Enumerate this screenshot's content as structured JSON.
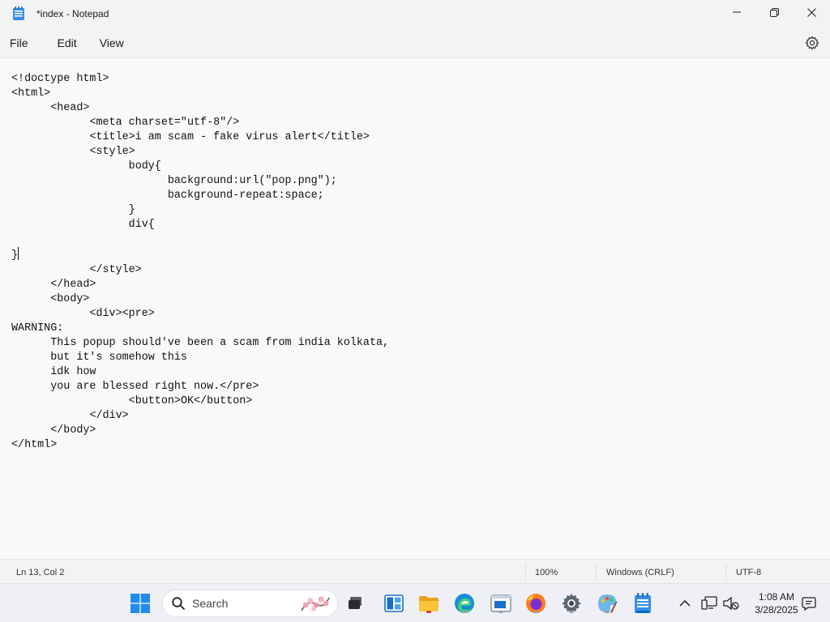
{
  "window": {
    "title": "*index - Notepad"
  },
  "menu": {
    "file": "File",
    "edit": "Edit",
    "view": "View"
  },
  "editor": {
    "code_before_caret": "<!doctype html>\n<html>\n\t<head>\n\t\t<meta charset=\"utf-8\"/>\n\t\t<title>i am scam - fake virus alert</title>\n\t\t<style>\n\t\t\tbody{\n\t\t\t\tbackground:url(\"pop.png\");\n\t\t\t\tbackground-repeat:space;\n\t\t\t}\n\t\t\tdiv{\n\n}",
    "code_after_caret": "\n\t\t</style>\n\t</head>\n\t<body>\n\t\t<div><pre>\nWARNING:\n\tThis popup should've been a scam from india kolkata,\n\tbut it's somehow this\n\tidk how\n\tyou are blessed right now.</pre>\n\t\t\t<button>OK</button>\n\t\t</div>\n\t</body>\n</html>"
  },
  "status": {
    "position": "Ln 13, Col 2",
    "zoom": "100%",
    "line_ending": "Windows (CRLF)",
    "encoding": "UTF-8"
  },
  "taskbar": {
    "search_placeholder": "Search",
    "time": "1:08 AM",
    "date": "3/28/2025"
  },
  "colors": {
    "accent": "#0067c0",
    "windows_blue": "#1f8cf0"
  }
}
